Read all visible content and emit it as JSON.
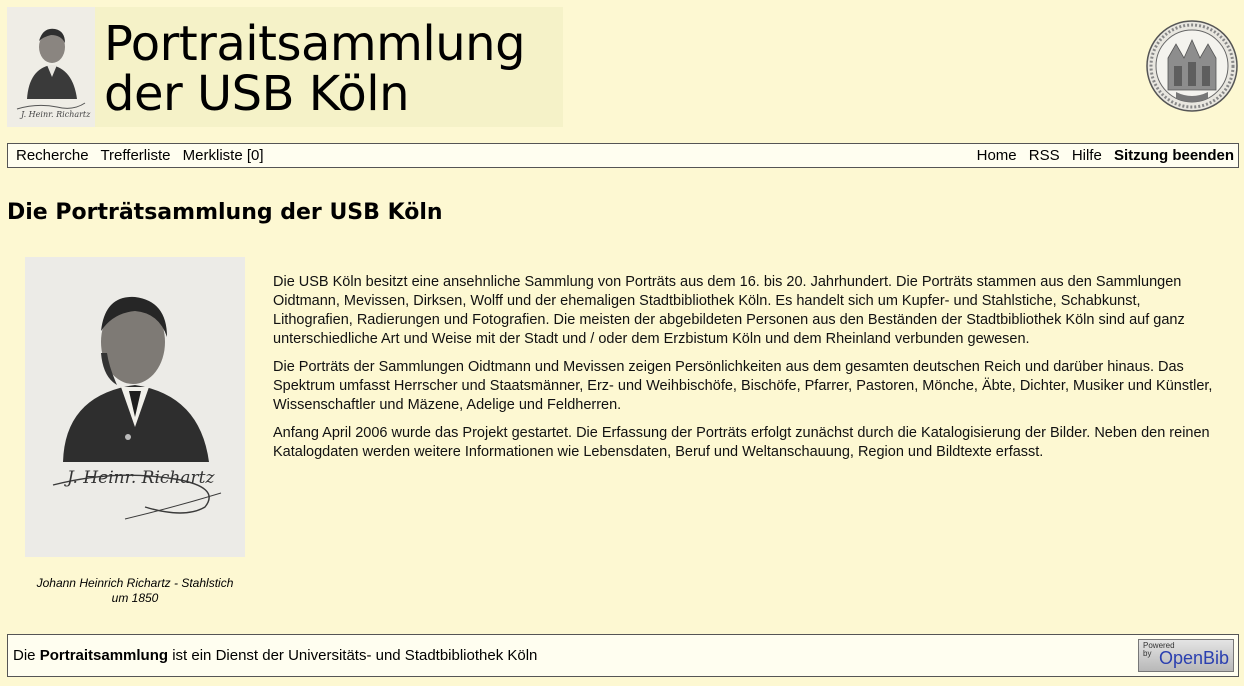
{
  "header": {
    "title_line1": "Portraitsammlung",
    "title_line2": "der USB Köln",
    "banner_signature": "J. Heinr. Richartz",
    "seal_icon": "university-seal-icon"
  },
  "nav": {
    "left": [
      "Recherche",
      "Trefferliste",
      "Merkliste [0]"
    ],
    "right": [
      "Home",
      "RSS",
      "Hilfe",
      "Sitzung beenden"
    ]
  },
  "main": {
    "title": "Die Porträtsammlung der USB Köln",
    "photo_signature": "J. Heinr. Richartz",
    "caption_line1": "Johann Heinrich Richartz - Stahlstich",
    "caption_line2": "um 1850",
    "paragraphs": [
      "Die USB Köln besitzt eine ansehnliche Sammlung von Porträts aus dem 16. bis 20. Jahrhundert. Die Porträts stammen aus den Sammlungen Oidtmann, Mevissen, Dirksen, Wolff und der ehemaligen Stadtbibliothek Köln. Es handelt sich um Kupfer- und Stahlstiche, Schabkunst, Lithografien, Radierungen und Fotografien. Die meisten der abgebildeten Personen aus den Beständen der Stadtbibliothek Köln sind auf ganz unterschiedliche Art und Weise mit der Stadt und / oder dem Erzbistum Köln und dem Rheinland verbunden gewesen.",
      "Die Porträts der Sammlungen Oidtmann und Mevissen zeigen Persönlichkeiten aus dem gesamten deutschen Reich und darüber hinaus. Das Spektrum umfasst Herrscher und Staatsmänner, Erz- und Weihbischöfe, Bischöfe, Pfarrer, Pastoren, Mönche, Äbte, Dichter, Musiker und Künstler, Wissenschaftler und Mäzene, Adelige und Feldherren.",
      "Anfang April 2006 wurde das Projekt gestartet. Die Erfassung der Porträts erfolgt zunächst durch die Katalogisierung der Bilder. Neben den reinen Katalogdaten werden weitere Informationen wie Lebensdaten, Beruf und Weltanschauung, Region und Bildtexte erfasst."
    ]
  },
  "footer": {
    "text_before": "Die ",
    "text_bold": "Portraitsammlung",
    "text_after": " ist ein Dienst der Universitäts- und Stadtbibliothek Köln",
    "badge_small_1": "Powered",
    "badge_small_2": "by",
    "badge_big": "OpenBib"
  },
  "colors": {
    "background": "#fdf8d2",
    "bar_background": "#fffef0",
    "link_blue": "#2a3fb0"
  }
}
